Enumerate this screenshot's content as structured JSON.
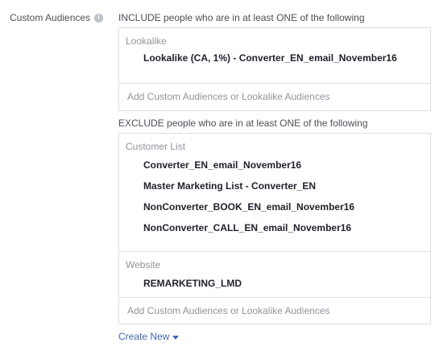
{
  "field": {
    "label": "Custom Audiences",
    "info_icon": "info-icon"
  },
  "include": {
    "heading": "INCLUDE people who are in at least ONE of the following",
    "groups": [
      {
        "title": "Lookalike",
        "items": [
          "Lookalike (CA, 1%) - Converter_EN_email_November16"
        ]
      }
    ],
    "add_placeholder": "Add Custom Audiences or Lookalike Audiences"
  },
  "exclude": {
    "heading": "EXCLUDE people who are in at least ONE of the following",
    "groups": [
      {
        "title": "Customer List",
        "items": [
          "Converter_EN_email_November16",
          "Master Marketing List - Converter_EN",
          "NonConverter_BOOK_EN_email_November16",
          "NonConverter_CALL_EN_email_November16"
        ]
      },
      {
        "title": "Website",
        "items": [
          "REMARKETING_LMD"
        ]
      }
    ],
    "add_placeholder": "Add Custom Audiences or Lookalike Audiences"
  },
  "create_new": {
    "label": "Create New",
    "icon": "caret-down-icon"
  },
  "colors": {
    "link": "#4267b2",
    "border": "#dddfe2",
    "muted": "#90949c",
    "text": "#1d2129"
  }
}
